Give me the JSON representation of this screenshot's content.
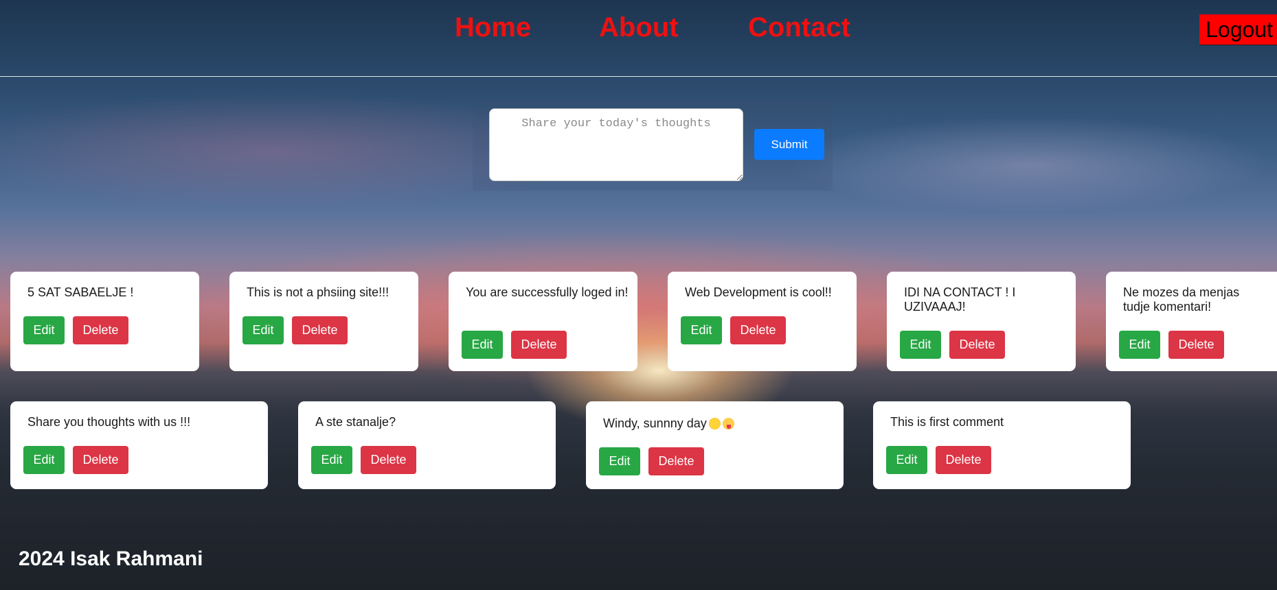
{
  "nav": {
    "links": [
      "Home",
      "About",
      "Contact"
    ],
    "logout": "Logout"
  },
  "composer": {
    "placeholder": "Share your today's thoughts",
    "submit": "Submit"
  },
  "comments": [
    {
      "text": "5 SAT SABAELJE !",
      "edit": "Edit",
      "delete": "Delete"
    },
    {
      "text": "This is not a phsiing site!!!",
      "edit": "Edit",
      "delete": "Delete"
    },
    {
      "text": "You are successfully loged in!",
      "edit": "Edit",
      "delete": "Delete"
    },
    {
      "text": "Web Development is cool!!",
      "edit": "Edit",
      "delete": "Delete"
    },
    {
      "text": "IDI NA CONTACT ! I UZIVAAAJ!",
      "edit": "Edit",
      "delete": "Delete"
    },
    {
      "text": "Ne mozes da menjas tudje komentari!",
      "edit": "Edit",
      "delete": "Delete"
    },
    {
      "text": "Share you thoughts with us !!!",
      "edit": "Edit",
      "delete": "Delete"
    },
    {
      "text": "A ste stanalje?",
      "edit": "Edit",
      "delete": "Delete"
    },
    {
      "text": "Windy, sunnny day",
      "edit": "Edit",
      "delete": "Delete",
      "emojis": [
        "sun-emoji",
        "tongue-face-emoji"
      ]
    },
    {
      "text": "This is first comment",
      "edit": "Edit",
      "delete": "Delete"
    }
  ],
  "footer": "2024 Isak Rahmani",
  "colors": {
    "nav_link": "#ee1111",
    "logout_bg": "#ff0000",
    "submit_bg": "#0b7bff",
    "edit_bg": "#28a745",
    "delete_bg": "#dc3545"
  }
}
